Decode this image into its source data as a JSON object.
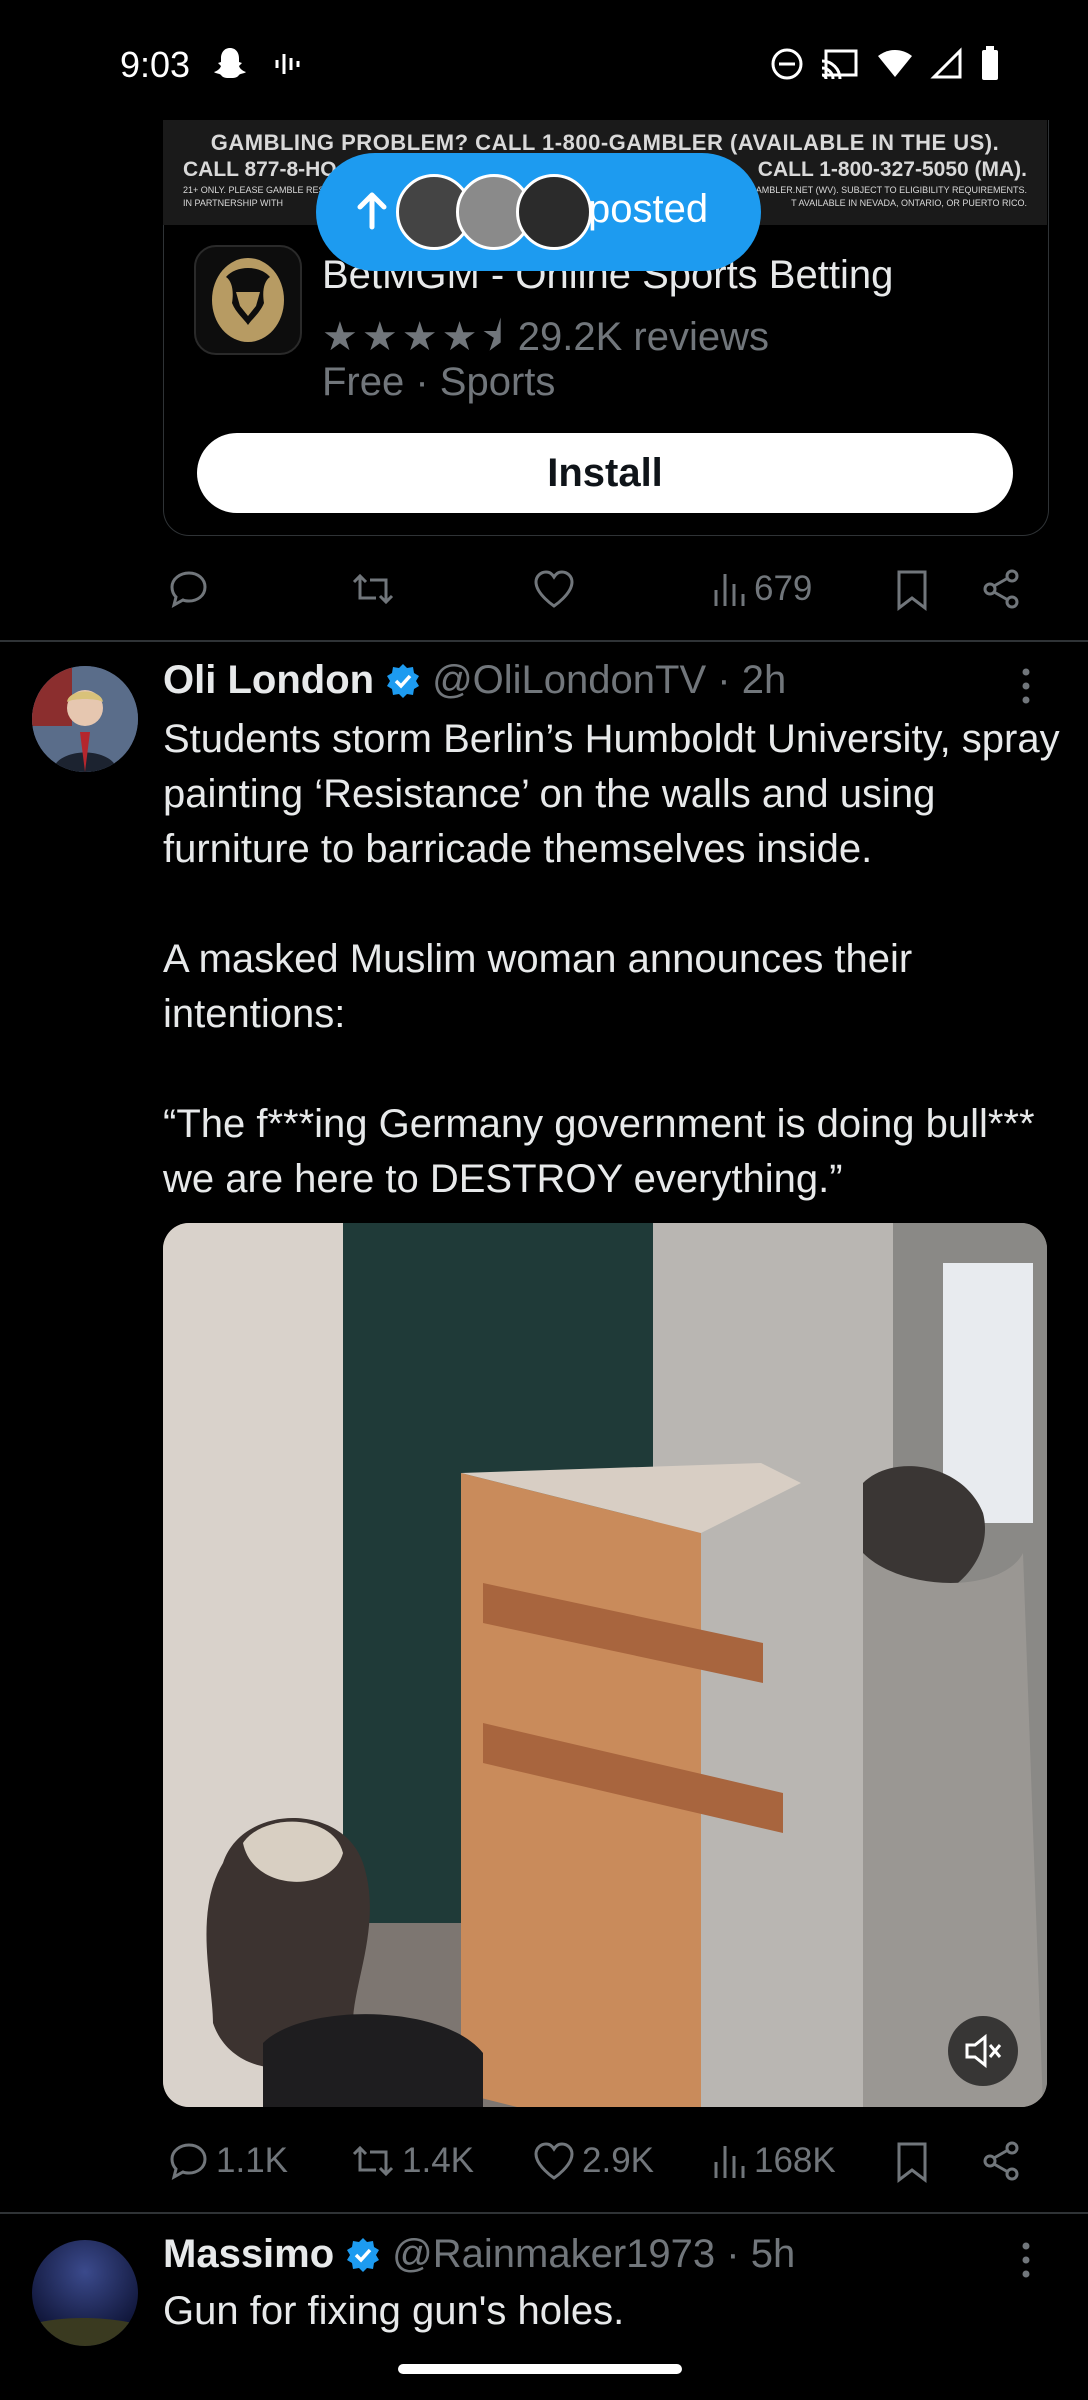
{
  "status_bar": {
    "time": "9:03"
  },
  "ad": {
    "banner_line1": "GAMBLING PROBLEM? CALL 1-800-GAMBLER (AVAILABLE IN THE US).",
    "banner_line2_left": "CALL 877-8-HO",
    "banner_line2_right": "CALL 1-800-327-5050 (MA).",
    "banner_line3_left": "21+ ONLY. PLEASE GAMBLE RESP",
    "banner_line3_right": "GAMBLER.NET (WV). SUBJECT TO ELIGIBILITY REQUIREMENTS.",
    "banner_line4_left": "IN PARTNERSHIP WITH",
    "banner_line4_right": "T AVAILABLE IN NEVADA, ONTARIO, OR PUERTO RICO.",
    "app_name": "BetMGM - Online Sports Betting",
    "stars": "★★★★⯨",
    "reviews": "29.2K reviews",
    "meta": "Free · Sports",
    "install_label": "Install",
    "views": "679"
  },
  "posted_pill": {
    "label": "posted"
  },
  "tweet1": {
    "name": "Oli London",
    "handle": "@OliLondonTV · 2h",
    "text": "Students storm Berlin’s Humboldt University, spray painting ‘Resistance’ on the walls and using furniture to barricade themselves inside.\n\nA masked Muslim woman announces their intentions:\n\n“The f***ing Germany government is doing bull*** we are here to DESTROY everything.”",
    "replies": "1.1K",
    "reposts": "1.4K",
    "likes": "2.9K",
    "views": "168K"
  },
  "tweet2": {
    "name": "Massimo",
    "handle": "@Rainmaker1973 · 5h",
    "text": "Gun for fixing gun's holes."
  },
  "colors": {
    "accent": "#1d9bf0",
    "muted": "#71767b",
    "text": "#e7e9ea",
    "bg": "#000000"
  }
}
